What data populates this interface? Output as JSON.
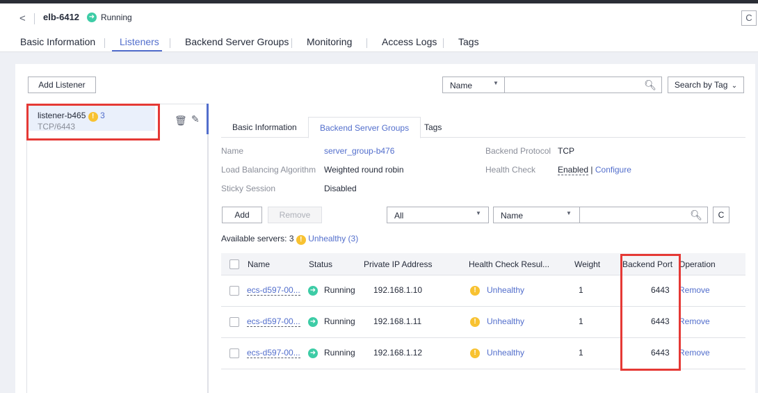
{
  "header": {
    "elb_name": "elb-6412",
    "status": "Running",
    "back_glyph": "<",
    "refresh_glyph": "C"
  },
  "tabs": [
    {
      "label": "Basic Information"
    },
    {
      "label": "Listeners"
    },
    {
      "label": "Backend Server Groups"
    },
    {
      "label": "Monitoring"
    },
    {
      "label": "Access Logs"
    },
    {
      "label": "Tags"
    }
  ],
  "toolbar": {
    "add_listener_label": "Add Listener",
    "filter_select": "Name",
    "search_tag_label": "Search by Tag"
  },
  "listener": {
    "name": "listener-b465",
    "warn_count": "3",
    "protocol": "TCP/6443"
  },
  "inner_tabs": [
    {
      "label": "Basic Information"
    },
    {
      "label": "Backend Server Groups"
    },
    {
      "label": "Tags"
    }
  ],
  "group": {
    "name_label": "Name",
    "name_value": "server_group-b476",
    "algo_label": "Load Balancing Algorithm",
    "algo_value": "Weighted round robin",
    "sticky_label": "Sticky Session",
    "sticky_value": "Disabled",
    "protocol_label": "Backend Protocol",
    "protocol_value": "TCP",
    "health_label": "Health Check",
    "health_enabled": "Enabled",
    "health_sep": "|",
    "health_configure": "Configure"
  },
  "servers_toolbar": {
    "add_label": "Add",
    "remove_label": "Remove",
    "status_select": "All",
    "field_select": "Name"
  },
  "available": {
    "text": "Available servers: 3",
    "unhealthy": "Unhealthy (3)"
  },
  "table": {
    "headers": [
      "Name",
      "Status",
      "Private IP Address",
      "Health Check Resul...",
      "Weight",
      "Backend Port",
      "Operation"
    ],
    "rows": [
      {
        "name": "ecs-d597-00...",
        "status": "Running",
        "ip": "192.168.1.10",
        "health": "Unhealthy",
        "weight": "1",
        "port": "6443",
        "op": "Remove"
      },
      {
        "name": "ecs-d597-00...",
        "status": "Running",
        "ip": "192.168.1.11",
        "health": "Unhealthy",
        "weight": "1",
        "port": "6443",
        "op": "Remove"
      },
      {
        "name": "ecs-d597-00...",
        "status": "Running",
        "ip": "192.168.1.12",
        "health": "Unhealthy",
        "weight": "1",
        "port": "6443",
        "op": "Remove"
      }
    ]
  },
  "icons": {
    "running": "running-arrow-icon",
    "warning": "warning-icon",
    "search": "search-icon",
    "trash": "trash-icon",
    "edit": "edit-icon"
  },
  "colors": {
    "accent": "#526ecc",
    "running": "#3dcca6",
    "warning": "#f8c231",
    "highlight": "#e53935"
  }
}
